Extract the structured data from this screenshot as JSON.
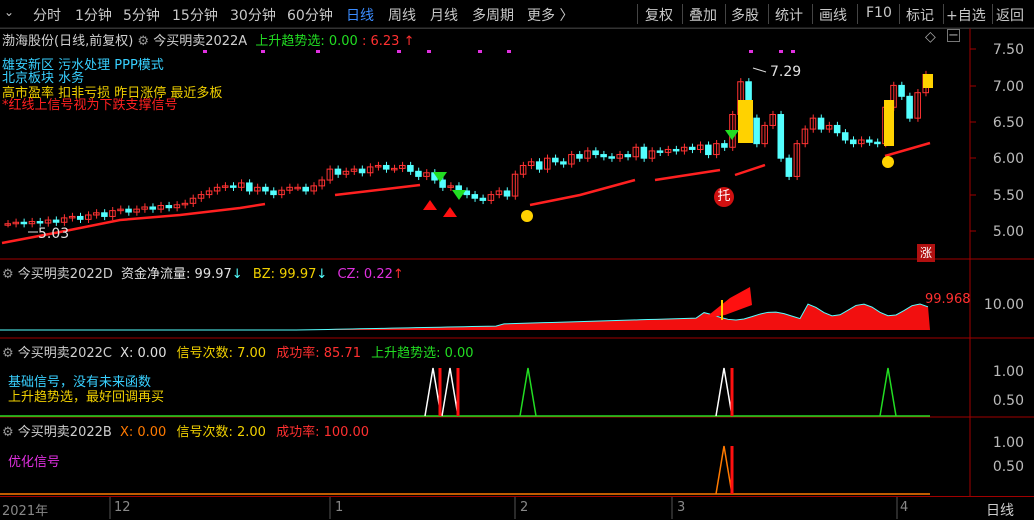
{
  "toolbar": {
    "left_items": [
      "分时",
      "1分钟",
      "5分钟",
      "15分钟",
      "30分钟",
      "60分钟",
      "日线",
      "周线",
      "月线",
      "多周期",
      "更多 〉"
    ],
    "active": "日线",
    "right_items": [
      "复权",
      "叠加",
      "多股",
      "统计",
      "画线",
      "F10",
      "标记",
      "+自选",
      "返回"
    ]
  },
  "main_panel": {
    "stock": "渤海股份(日线,前复权)",
    "indicator": "今买明卖2022A",
    "up_trend_label": "上升趋势选: 0.00",
    "price_label": ": 6.23",
    "up_arrow": "↑",
    "concepts_line1": "雄安新区 污水处理 PPP模式",
    "concepts_line2": "北京板块 水务",
    "concepts_line3": "高市盈率 扣非亏损 昨日涨停 最近多板",
    "concepts_line4": "*红线上信号视为下跌支撑信号",
    "high_marker": "7.29",
    "low_marker": "5.03",
    "tuo_badge": "托",
    "zhang_badge": "涨",
    "y_ticks": [
      "7.50",
      "7.00",
      "6.50",
      "6.00",
      "5.50",
      "5.00"
    ]
  },
  "panel_d": {
    "indicator": "今买明卖2022D",
    "flow": "资金净流量: 99.97",
    "bz": "BZ: 99.97",
    "cz": "CZ: 0.22",
    "down_arrow": "↓",
    "up_arrow": "↑",
    "value_label": "99.968",
    "y_tick": "10.00"
  },
  "panel_c": {
    "indicator": "今买明卖2022C",
    "x": "X: 0.00",
    "signals": "信号次数: 7.00",
    "success": "成功率: 85.71",
    "trend": "上升趋势选: 0.00",
    "note1": "基础信号，没有未来函数",
    "note2": "上升趋势选，最好回调再买",
    "y_ticks": [
      "1.00",
      "0.50"
    ]
  },
  "panel_b": {
    "indicator": "今买明卖2022B",
    "x": "X: 0.00",
    "signals": "信号次数: 2.00",
    "success": "成功率: 100.00",
    "note": "优化信号",
    "y_ticks": [
      "1.00",
      "0.50"
    ]
  },
  "time_axis": {
    "labels": [
      "2021年",
      "12",
      "1",
      "2",
      "3",
      "4"
    ],
    "period_button": "日线"
  },
  "colors": {
    "up": "#ff3333",
    "down": "#54ffff",
    "active": "#3b8cff",
    "grid": "#a00000"
  }
}
